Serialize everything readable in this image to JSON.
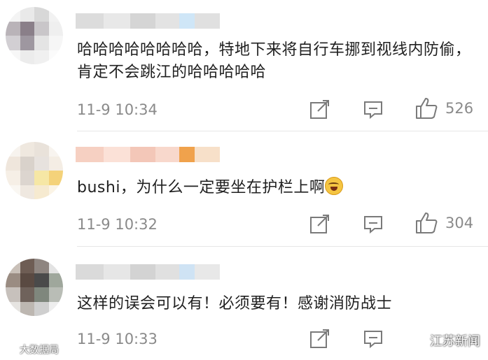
{
  "comments": [
    {
      "text": "哈哈哈哈哈哈哈哈，特地下来将自行车挪到视线内防偷，肯定不会跳江的哈哈哈哈哈",
      "time": "11-9 10:34",
      "likes": "526",
      "avatar_colors": [
        "#f4f4f4",
        "#e9e9e9",
        "#d8d8d8",
        "#f2f2f2",
        "#b9b3b8",
        "#8a7f89",
        "#c9c6c9",
        "#efefef",
        "#d2cfd3",
        "#9e97a0",
        "#e4e4e4",
        "#f6f6f6",
        "#f7f7f7",
        "#ececec",
        "#f0f0f0",
        "#fbfbfb"
      ],
      "username_colors": [
        "#dcdcdc",
        "#e8e8e8",
        "#d5d5d5",
        "#e3e3e3",
        "#cfe6f7",
        "#e0e0e0"
      ]
    },
    {
      "text": "bushi，为什么一定要坐在护栏上啊",
      "time": "11-9 10:32",
      "likes": "304",
      "avatar_colors": [
        "#f7f3ee",
        "#efe8df",
        "#e9e2da",
        "#f8f4ef",
        "#efe6dc",
        "#d9d2cb",
        "#e7e2de",
        "#f4ede4",
        "#f6efe6",
        "#dcd5cf",
        "#f6e7a5",
        "#f4d27a",
        "#faf7f2",
        "#efe8e0",
        "#f6ead0",
        "#fbf4e6"
      ],
      "username_colors": [
        "#f6d0c2",
        "#fbe1d7",
        "#f3c7b8",
        "#f8d8cc",
        "#f0a24c",
        "#f7e0c9"
      ]
    },
    {
      "text": "这样的误会可以有！必须要有！感谢消防战士",
      "time": "11-9 10:33",
      "likes": "",
      "avatar_colors": [
        "#c9c0b8",
        "#6e5d54",
        "#8e8580",
        "#e3e3e3",
        "#9a8c82",
        "#5a4a42",
        "#4a4a4a",
        "#9fa79c",
        "#c7c1bc",
        "#6f625b",
        "#7f877d",
        "#b9bdb6",
        "#e6e4e1",
        "#bdb7b1",
        "#cfcfcf",
        "#eeeeee"
      ],
      "username_colors": [
        "#dadada",
        "#e6e6e6",
        "#d3d3d3",
        "#e0e0e0",
        "#cfe3f4",
        "#e8e8e8"
      ]
    }
  ],
  "watermark_left": "大数据局",
  "watermark_right": "江苏新闻"
}
